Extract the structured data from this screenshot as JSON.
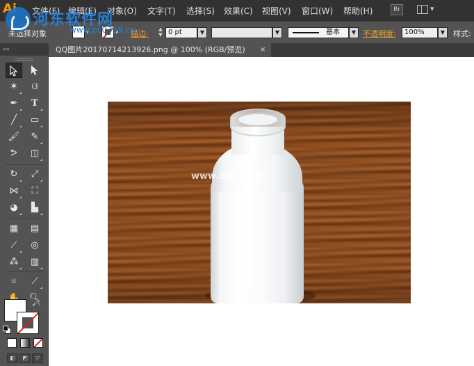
{
  "app": {
    "logo": "Ai"
  },
  "watermark": {
    "title": "河东软件网",
    "url": "www.pc0359.cn",
    "photo_text": "www.home.NET"
  },
  "menu": {
    "items": [
      "文件(F)",
      "编辑(E)",
      "对象(O)",
      "文字(T)",
      "选择(S)",
      "效果(C)",
      "视图(V)",
      "窗口(W)",
      "帮助(H)"
    ],
    "bridge_label": "Br"
  },
  "control_bar": {
    "selection_label": "未选择对象",
    "stroke_label": "描边:",
    "stroke_weight": "0 pt",
    "brush_label": "基本",
    "opacity_label": "不透明度:",
    "opacity_value": "100%",
    "style_label": "样式:"
  },
  "panel_strip": {
    "label": "««"
  },
  "document_tab": {
    "title": "QQ图片20170714213926.png @ 100% (RGB/预览)",
    "close": "×"
  },
  "tools": [
    "selection-tool",
    "direct-selection-tool",
    "magic-wand-tool",
    "lasso-tool",
    "pen-tool",
    "type-tool",
    "line-segment-tool",
    "rectangle-tool",
    "paintbrush-tool",
    "pencil-tool",
    "blob-brush-tool",
    "eraser-tool",
    "rotate-tool",
    "scale-tool",
    "width-tool",
    "free-transform-tool",
    "shape-builder-tool",
    "perspective-grid-tool",
    "mesh-tool",
    "gradient-tool",
    "eyedropper-tool",
    "blend-tool",
    "symbol-sprayer-tool",
    "column-graph-tool",
    "artboard-tool",
    "slice-tool",
    "hand-tool",
    "zoom-tool"
  ],
  "colors": {
    "fill": "#ffffff",
    "stroke": "none",
    "accent_orange": "#f0a030",
    "menubar_bg": "#323232",
    "panel_bg": "#535353"
  }
}
